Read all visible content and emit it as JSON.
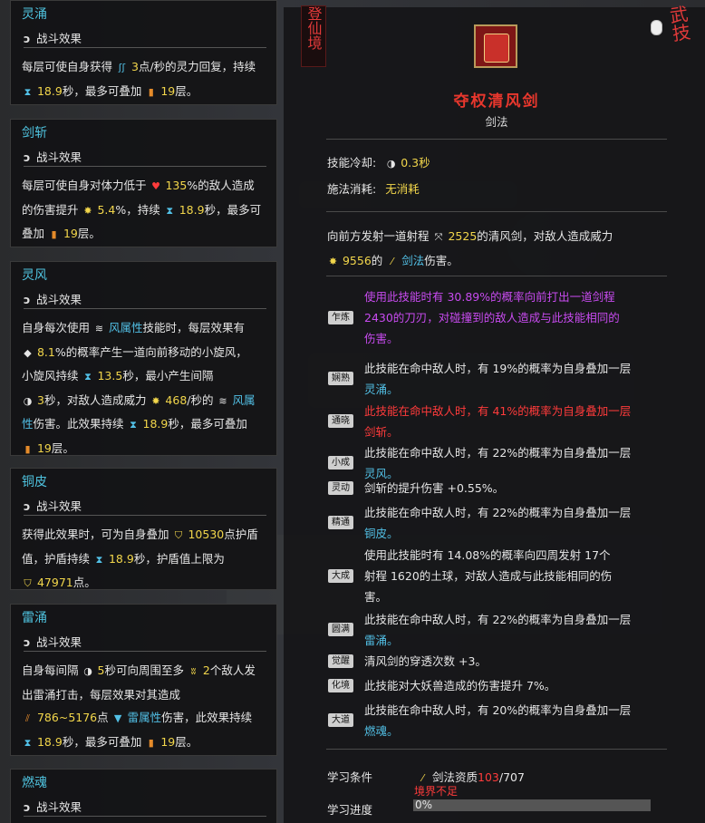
{
  "header": {
    "side_tab": "登仙境",
    "corner_label": "武技"
  },
  "skill": {
    "name": "夺权清风剑",
    "type": "剑法",
    "cooldown_label": "技能冷却:",
    "cooldown_value": "0.3秒",
    "cost_label": "施法消耗:",
    "cost_value": "无消耗",
    "desc_a": "向前方发射一道射程",
    "desc_range": "2525",
    "desc_b": "的清风剑，对敌人造成威力",
    "desc_power": "9556",
    "desc_c": "的",
    "desc_type": "剑法",
    "desc_d": "伤害。"
  },
  "levels": [
    {
      "tag": "乍炼",
      "lines": [
        {
          "text": "使用此技能时有 30.89%的概率向前打出一道剑程",
          "color": "purple"
        },
        {
          "text": "2430的刀刃，对碰撞到的敌人造成与此技能相同的",
          "color": "purple"
        },
        {
          "text": "伤害。",
          "color": "purple"
        }
      ]
    },
    {
      "tag": "娴熟",
      "lines": [
        {
          "text": "此技能在命中敌人时，有 19%的概率为自身叠加一层",
          "color": "white"
        },
        {
          "text": "灵涌。",
          "color": "blue"
        }
      ]
    },
    {
      "tag": "通晓",
      "lines": [
        {
          "text": "此技能在命中敌人时，有 41%的概率为自身叠加一层",
          "color": "red"
        },
        {
          "text": "剑斩。",
          "color": "red"
        }
      ]
    },
    {
      "tag": "小成",
      "lines": [
        {
          "text": "此技能在命中敌人时，有 22%的概率为自身叠加一层",
          "color": "white"
        },
        {
          "text": "灵风。",
          "color": "blue"
        }
      ]
    },
    {
      "tag": "灵动",
      "lines": [
        {
          "text": "剑斩的提升伤害 +0.55%。",
          "color": "white"
        }
      ]
    },
    {
      "tag": "精通",
      "lines": [
        {
          "text": "此技能在命中敌人时，有 22%的概率为自身叠加一层",
          "color": "white"
        },
        {
          "text": "铜皮。",
          "color": "blue"
        }
      ]
    },
    {
      "tag": "大成",
      "lines": [
        {
          "text": "使用此技能时有 14.08%的概率向四周发射 17个",
          "color": "white"
        },
        {
          "text": "射程 1620的土球，对敌人造成与此技能相同的伤",
          "color": "white"
        },
        {
          "text": "害。",
          "color": "white"
        }
      ]
    },
    {
      "tag": "圆满",
      "lines": [
        {
          "text": "此技能在命中敌人时，有 22%的概率为自身叠加一层",
          "color": "white"
        },
        {
          "text": "雷涌。",
          "color": "blue"
        }
      ]
    },
    {
      "tag": "觉醒",
      "lines": [
        {
          "text": "清风剑的穿透次数 +3。",
          "color": "white"
        }
      ]
    },
    {
      "tag": "化境",
      "lines": [
        {
          "text": "此技能对大妖兽造成的伤害提升 7%。",
          "color": "white"
        }
      ]
    },
    {
      "tag": "大道",
      "lines": [
        {
          "text": "此技能在命中敌人时，有 20%的概率为自身叠加一层",
          "color": "white"
        },
        {
          "text": "燃魂。",
          "color": "blue"
        }
      ]
    }
  ],
  "learn": {
    "cond_label": "学习条件",
    "cond_text": "剑法资质",
    "cond_cur": "103",
    "cond_max": "/707",
    "cond_warn": "境界不足",
    "prog_label": "学习进度",
    "prog_value": "0%",
    "progress": 0
  },
  "buffs": [
    {
      "title": "灵涌",
      "sub": "战斗效果"
    },
    {
      "title": "剑斩",
      "sub": "战斗效果"
    },
    {
      "title": "灵风",
      "sub": "战斗效果"
    },
    {
      "title": "铜皮",
      "sub": "战斗效果"
    },
    {
      "title": "雷涌",
      "sub": "战斗效果"
    },
    {
      "title": "燃魂",
      "sub": "战斗效果"
    }
  ],
  "buff_text": {
    "b0": [
      "每层可使自身获得",
      "3",
      "点/秒的灵力回复，持续",
      "18.9",
      "秒，最多可叠加",
      "19",
      "层。"
    ],
    "b1": [
      "每层可使自身对体力低于",
      "135",
      "%的敌人造成",
      "的伤害提升",
      "5.4",
      "%，持续",
      "18.9",
      "秒，最多可",
      "叠加",
      "19",
      "层。"
    ],
    "b2": [
      "自身每次使用",
      "风属性",
      "技能时，每层效果有",
      "8.1",
      "%的概率产生一道向前移动的小旋风，",
      "小旋风持续",
      "13.5",
      "秒，最小产生间隔",
      "3",
      "秒，对敌人造成威力",
      "468",
      "/秒的",
      "风属",
      "性",
      "伤害。此效果持续",
      "18.9",
      "秒，最多可叠加",
      "19",
      "层。"
    ],
    "b3": [
      "获得此效果时，可为自身叠加",
      "10530",
      "点护盾",
      "值，护盾持续",
      "18.9",
      "秒，护盾值上限为",
      "47971",
      "点。"
    ],
    "b4": [
      "自身每间隔",
      "5",
      "秒可向周围至多",
      "2",
      "个敌人发",
      "出雷涌打击，每层效果对其造成",
      "786~5176",
      "点",
      "雷属性",
      "伤害，此效果持续",
      "18.9",
      "秒，最多可叠加",
      "19",
      "层。"
    ]
  },
  "colors": {
    "accent_red": "#e8372d",
    "buff_blue": "#4fc3df",
    "value_yellow": "#f2d64b",
    "purple": "#c84bf0"
  }
}
